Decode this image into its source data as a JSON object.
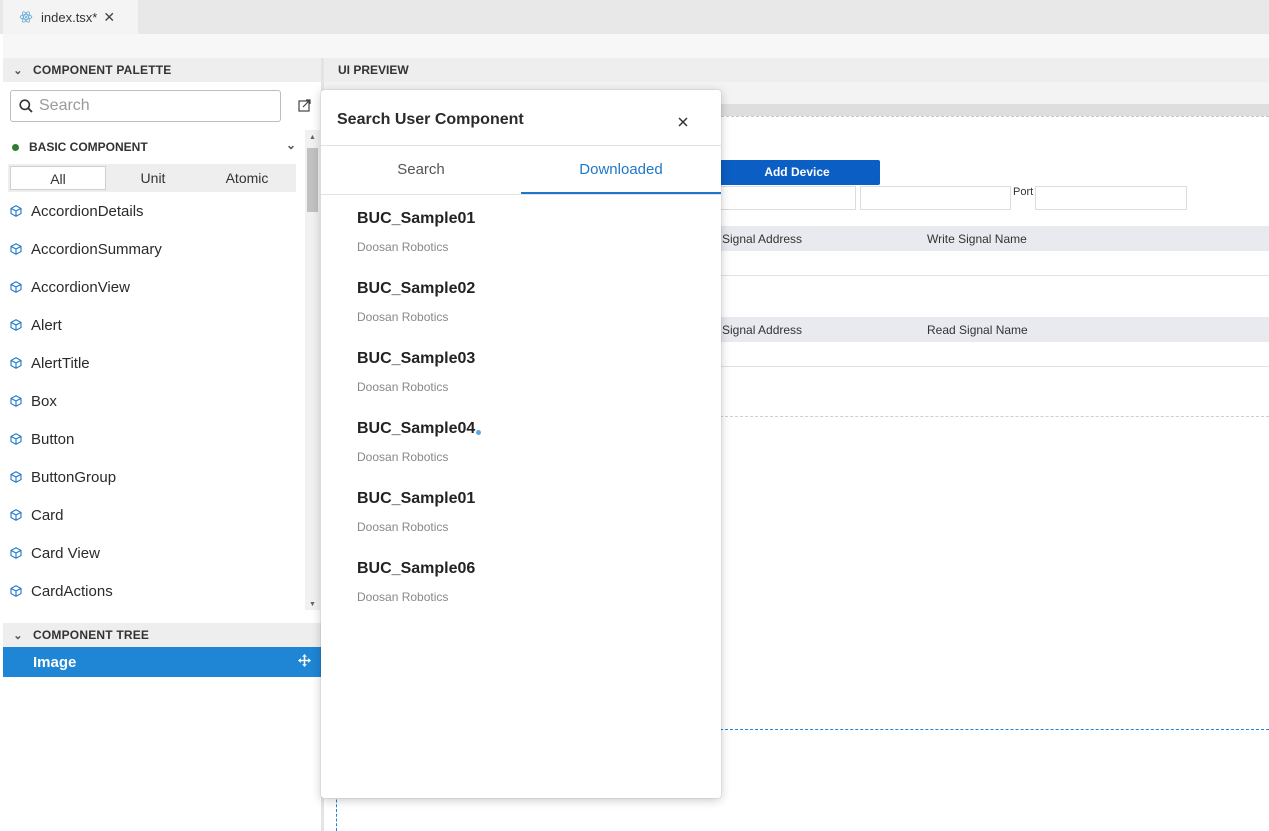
{
  "tabbar": {
    "file_tab": "index.tsx*",
    "file_tab_icon": "react-icon",
    "close_icon": "close-icon"
  },
  "palette": {
    "title": "COMPONENT PALETTE",
    "search_placeholder": "Search",
    "category": {
      "label": "BASIC COMPONENT",
      "status_color": "#2e7d32"
    },
    "filters": [
      "All",
      "Unit",
      "Atomic"
    ],
    "active_filter": "All",
    "components": [
      "AccordionDetails",
      "AccordionSummary",
      "AccordionView",
      "Alert",
      "AlertTitle",
      "Box",
      "Button",
      "ButtonGroup",
      "Card",
      "Card View",
      "CardActions"
    ]
  },
  "tree": {
    "title": "COMPONENT TREE",
    "selected_item": "Image",
    "selected_color": "#1e86d4"
  },
  "preview": {
    "title": "UI PREVIEW",
    "add_device_label": "Add Device",
    "port_label": "Port",
    "write_header": {
      "signal_address": "Signal Address",
      "signal_name": "Write Signal Name"
    },
    "read_header": {
      "signal_address": "Signal Address",
      "signal_name": "Read Signal Name"
    },
    "accent_color": "#0b5fc4"
  },
  "modal": {
    "title": "Search User Component",
    "tabs": [
      "Search",
      "Downloaded"
    ],
    "active_tab": "Downloaded",
    "accent_color": "#1e78c8",
    "items": [
      {
        "name": "BUC_Sample01",
        "vendor": "Doosan Robotics"
      },
      {
        "name": "BUC_Sample02",
        "vendor": "Doosan Robotics"
      },
      {
        "name": "BUC_Sample03",
        "vendor": "Doosan Robotics"
      },
      {
        "name": "BUC_Sample04",
        "vendor": "Doosan Robotics"
      },
      {
        "name": "BUC_Sample01",
        "vendor": "Doosan Robotics"
      },
      {
        "name": "BUC_Sample06",
        "vendor": "Doosan Robotics"
      }
    ]
  }
}
